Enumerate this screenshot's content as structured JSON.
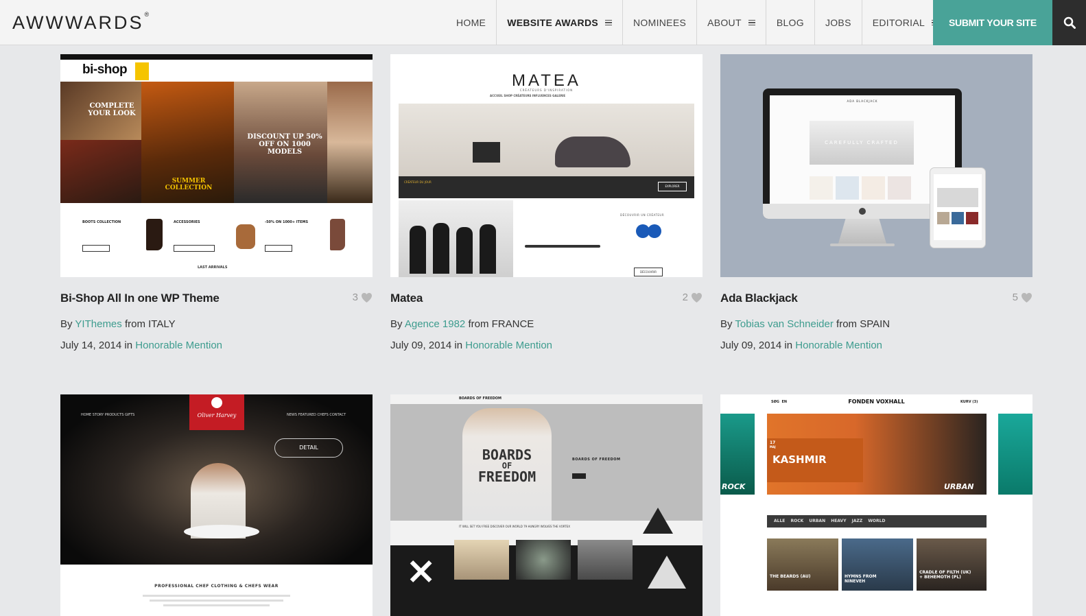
{
  "header": {
    "logo": "AWWWARDS",
    "logo_mark": "®",
    "nav": [
      {
        "label": "HOME",
        "menu": false,
        "bold": false
      },
      {
        "label": "WEBSITE AWARDS",
        "menu": true,
        "bold": true
      },
      {
        "label": "NOMINEES",
        "menu": false,
        "bold": false
      },
      {
        "label": "ABOUT",
        "menu": true,
        "bold": false
      },
      {
        "label": "BLOG",
        "menu": false,
        "bold": false
      },
      {
        "label": "JOBS",
        "menu": false,
        "bold": false
      },
      {
        "label": "EDITORIAL",
        "menu": true,
        "bold": false
      }
    ],
    "submit_label": "SUBMIT YOUR SITE",
    "accent_color": "#49a398"
  },
  "cards": [
    {
      "title": "Bi-Shop All In one WP Theme",
      "likes": "3",
      "by": "By",
      "author": "YIThemes",
      "from": "from",
      "country": "ITALY",
      "date": "July 14, 2014",
      "in": "in",
      "award": "Honorable Mention"
    },
    {
      "title": "Matea",
      "likes": "2",
      "by": "By",
      "author": "Agence 1982",
      "from": "from",
      "country": "FRANCE",
      "date": "July 09, 2014",
      "in": "in",
      "award": "Honorable Mention"
    },
    {
      "title": "Ada Blackjack",
      "likes": "5",
      "by": "By",
      "author": "Tobias van Schneider",
      "from": "from",
      "country": "SPAIN",
      "date": "July 09, 2014",
      "in": "in",
      "award": "Honorable Mention"
    }
  ],
  "thumbs": {
    "bishop": {
      "logo": "bi-shop",
      "hero1": "COMPLETE YOUR LOOK",
      "hero2": "DISCOUNT UP 50% OFF ON 1000 MODELS",
      "hero3": "SUMMER COLLECTION",
      "col1": "BOOTS COLLECTION",
      "col2": "ACCESSORIES",
      "col3": "-50% ON 1000+ ITEMS",
      "footer": "LAST ARRIVALS"
    },
    "matea": {
      "logo": "MATEA",
      "tagline": "CRÉATEURS D'INSPIRATION",
      "menu": "ACCUEIL   SHOP   CRÉATEURS   INFLUENCES   GALERIE",
      "strip": "CRÉATEUR DU JOUR",
      "cta": "EXPLORER",
      "discover": "DÉCOUVRIR UN CRÉATEUR",
      "btn": "DÉCOUVRIR"
    },
    "ada": {
      "hero": "CAREFULLY CRAFTED",
      "brand": "ADA BLACKJACK"
    },
    "oliver": {
      "brand": "Oliver Harvey",
      "detail": "DETAIL",
      "nav_left": "HOME   STORY   PRODUCTS   GIFTS",
      "nav_right": "NEWS   FEATURED CHEFS   CONTACT",
      "caption": "PROFESSIONAL CHEF CLOTHING & CHEFS WEAR"
    },
    "boards": {
      "brand": "BOARDS OF FREEDOM",
      "shirt1": "BOARDS",
      "shirt2": "OF",
      "shirt3": "FREEDOM",
      "label": "BOARDS OF FREEDOM",
      "menu": "IT WILL SET YOU FREE   DISCOVER OUR WORLD   79 HUNGRY WOLVES   THE VORTEX"
    },
    "voxhall": {
      "brand": "FONDEN VOXHALL",
      "search": "SØG",
      "lang": "EN",
      "cart": "KURV (3)",
      "band": "KASHMIR",
      "day": "17",
      "month": "MAJ",
      "tag1": "ROCK",
      "tag2": "URBAN",
      "filters": [
        "ALLE",
        "ROCK",
        "URBAN",
        "HEAVY",
        "JAZZ",
        "WORLD"
      ],
      "event1": "THE BEARDS (AU)",
      "event2": "HYMNS FROM NINEVEH",
      "event3": "CRADLE OF FILTH (UK) + BEHEMOTH (PL)"
    }
  }
}
